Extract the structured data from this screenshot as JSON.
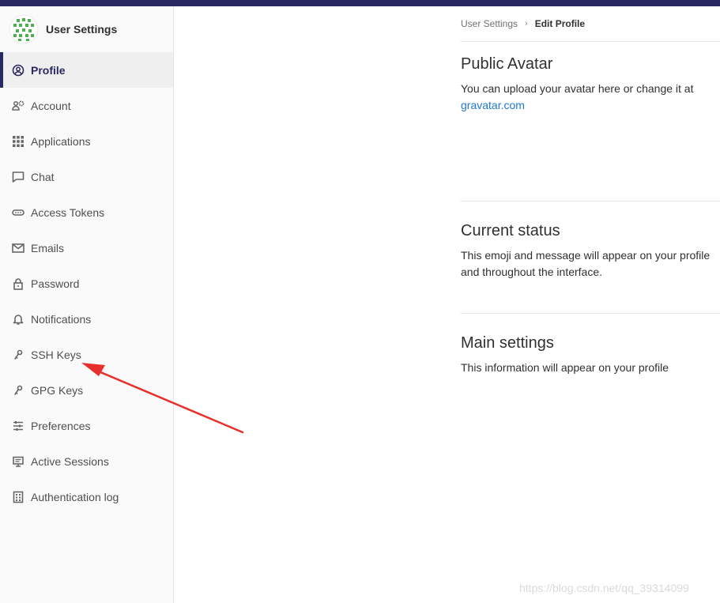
{
  "sidebar": {
    "title": "User Settings",
    "items": [
      {
        "label": "Profile",
        "icon": "profile-icon",
        "active": true
      },
      {
        "label": "Account",
        "icon": "account-icon"
      },
      {
        "label": "Applications",
        "icon": "applications-icon"
      },
      {
        "label": "Chat",
        "icon": "chat-icon"
      },
      {
        "label": "Access Tokens",
        "icon": "token-icon"
      },
      {
        "label": "Emails",
        "icon": "email-icon"
      },
      {
        "label": "Password",
        "icon": "lock-icon"
      },
      {
        "label": "Notifications",
        "icon": "bell-icon"
      },
      {
        "label": "SSH Keys",
        "icon": "key-icon"
      },
      {
        "label": "GPG Keys",
        "icon": "key-icon"
      },
      {
        "label": "Preferences",
        "icon": "sliders-icon"
      },
      {
        "label": "Active Sessions",
        "icon": "monitor-icon"
      },
      {
        "label": "Authentication log",
        "icon": "log-icon"
      }
    ]
  },
  "breadcrumb": {
    "parent": "User Settings",
    "current": "Edit Profile"
  },
  "sections": {
    "avatar": {
      "title": "Public Avatar",
      "text": "You can upload your avatar here or change it at",
      "link": "gravatar.com"
    },
    "status": {
      "title": "Current status",
      "text": "This emoji and message will appear on your profile and throughout the interface."
    },
    "main": {
      "title": "Main settings",
      "text": "This information will appear on your profile"
    }
  },
  "watermark": "https://blog.csdn.net/qq_39314099",
  "colors": {
    "topbar": "#292961",
    "active": "#292961",
    "link": "#1f78d1",
    "arrow": "#e8302a"
  }
}
